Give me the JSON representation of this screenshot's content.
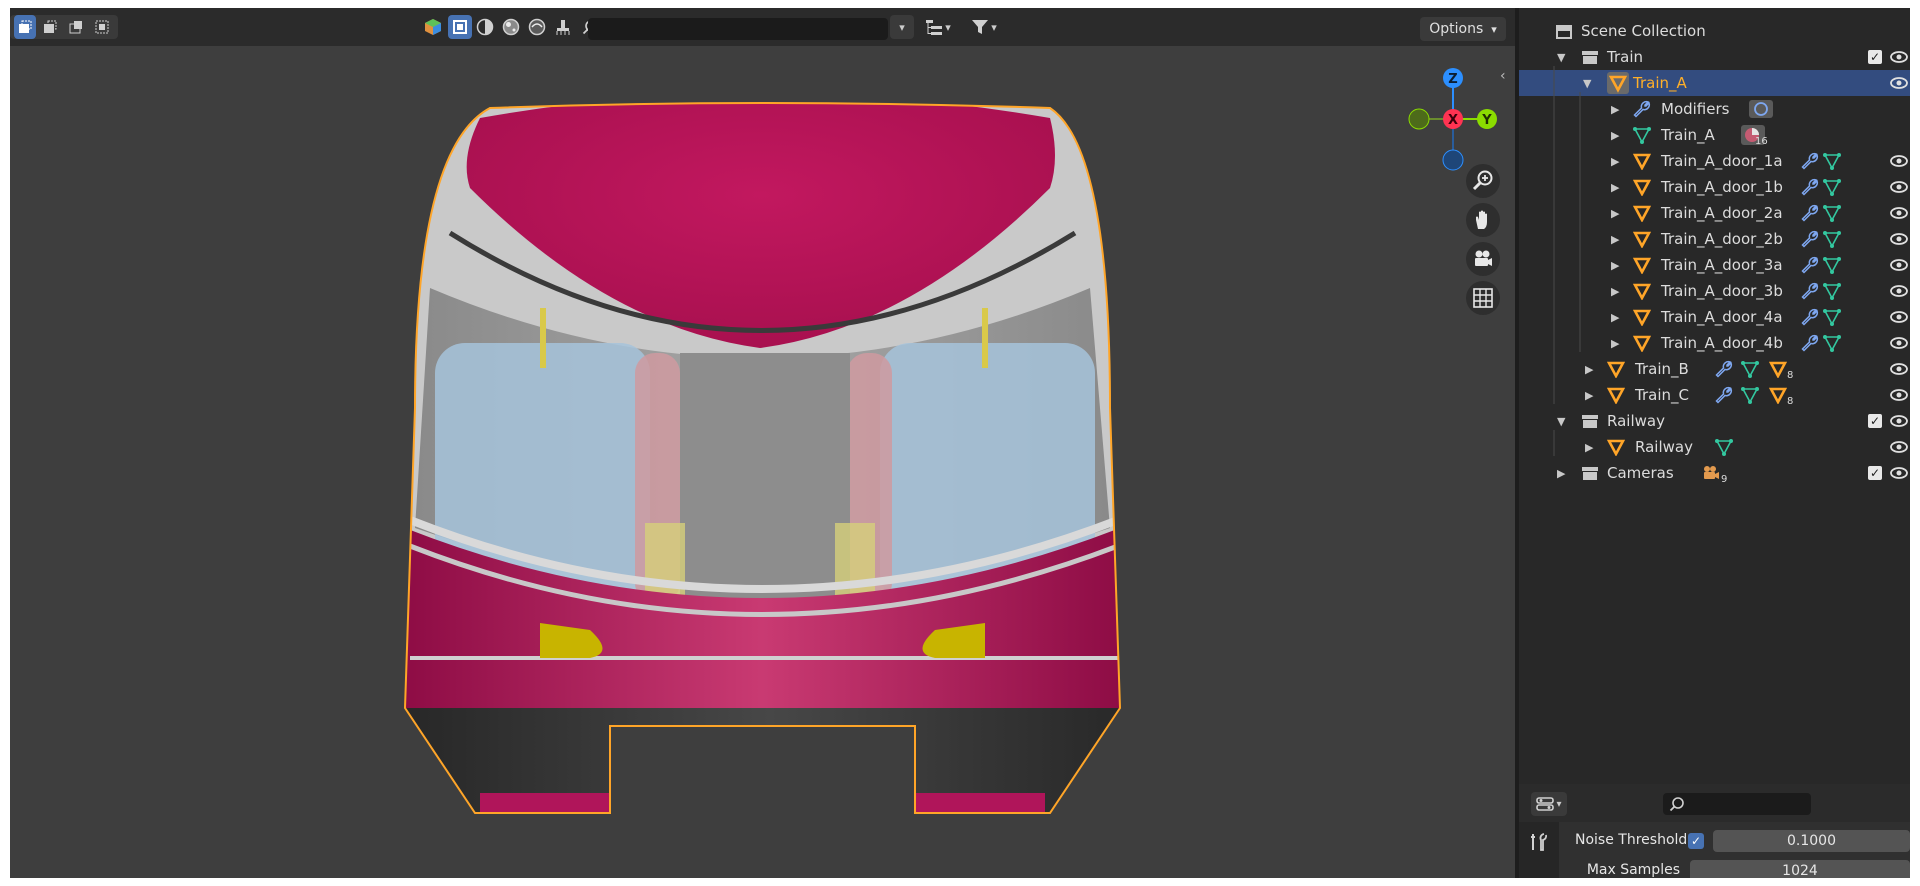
{
  "viewport": {
    "header": {
      "search": {
        "placeholder": ""
      },
      "options_label": "Options"
    },
    "gizmo": {
      "z": "Z",
      "x": "X",
      "y": "Y"
    }
  },
  "outliner": {
    "rows": [
      {
        "label": "Scene Collection"
      },
      {
        "label": "Train"
      },
      {
        "label": "Train_A"
      },
      {
        "label": "Modifiers"
      },
      {
        "label": "Train_A"
      },
      {
        "label": "Train_A_door_1a"
      },
      {
        "label": "Train_A_door_1b"
      },
      {
        "label": "Train_A_door_2a"
      },
      {
        "label": "Train_A_door_2b"
      },
      {
        "label": "Train_A_door_3a"
      },
      {
        "label": "Train_A_door_3b"
      },
      {
        "label": "Train_A_door_4a"
      },
      {
        "label": "Train_A_door_4b"
      },
      {
        "label": "Train_B"
      },
      {
        "label": "Train_C"
      },
      {
        "label": "Railway"
      },
      {
        "label": "Railway"
      },
      {
        "label": "Cameras"
      }
    ],
    "badges": {
      "mesh_users": "16",
      "train_b_children": "8",
      "train_c_children": "8",
      "cameras_count": "9"
    }
  },
  "properties": {
    "search": {
      "placeholder": ""
    },
    "noise_threshold": {
      "label": "Noise Threshold",
      "enabled": true,
      "value": "0.1000"
    },
    "max_samples": {
      "label": "Max Samples",
      "value": "1024"
    }
  },
  "colors": {
    "selection": "#334c7f",
    "active_object": "#ffaf29",
    "train_body": "#b0155a",
    "outline": "#ffa528",
    "axis_x": "#ff3352",
    "axis_y": "#8bdc00",
    "axis_z": "#2c8fff"
  }
}
